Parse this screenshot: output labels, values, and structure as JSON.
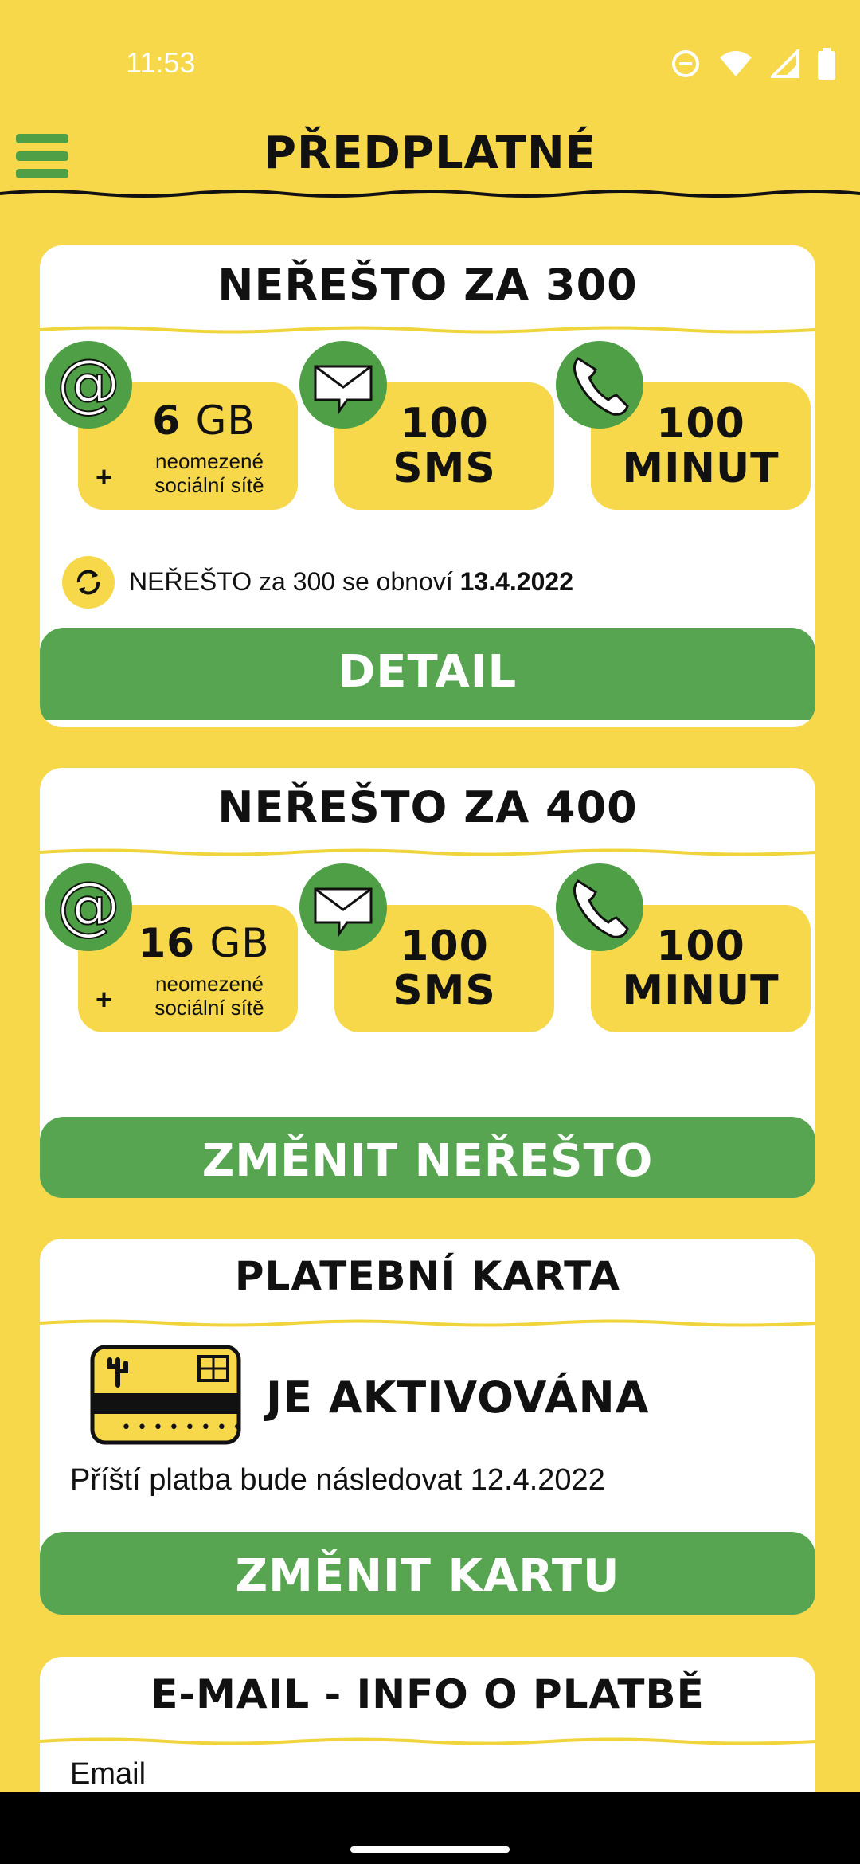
{
  "status_bar": {
    "time": "11:53"
  },
  "header": {
    "title": "PŘEDPLATNÉ"
  },
  "plans": [
    {
      "title": "NEŘEŠTO ZA 300",
      "data_amount": "6",
      "data_unit": "GB",
      "data_extra_line1": "neomezené",
      "data_extra_line2": "sociální sítě",
      "sms_value": "100",
      "sms_unit": "SMS",
      "minutes_value": "100",
      "minutes_unit": "MINUT",
      "renew_text": "NEŘEŠTO za 300 se obnoví",
      "renew_date": "13.4.2022",
      "button_label": "DETAIL"
    },
    {
      "title": "NEŘEŠTO ZA 400",
      "data_amount": "16",
      "data_unit": "GB",
      "data_extra_line1": "neomezené",
      "data_extra_line2": "sociální sítě",
      "sms_value": "100",
      "sms_unit": "SMS",
      "minutes_value": "100",
      "minutes_unit": "MINUT",
      "button_label": "ZMĚNIT NEŘEŠTO"
    }
  ],
  "card": {
    "title": "PLATEBNÍ KARTA",
    "status": "JE AKTIVOVÁNA",
    "next_payment": "Příští platba bude následovat 12.4.2022",
    "button_label": "ZMĚNIT KARTU"
  },
  "email_section": {
    "title": "E-MAIL - INFO O PLATBĚ",
    "field_label": "Email"
  },
  "colors": {
    "background": "#F6D84A",
    "accent_green": "#57A551",
    "card": "#FFFFFF"
  }
}
